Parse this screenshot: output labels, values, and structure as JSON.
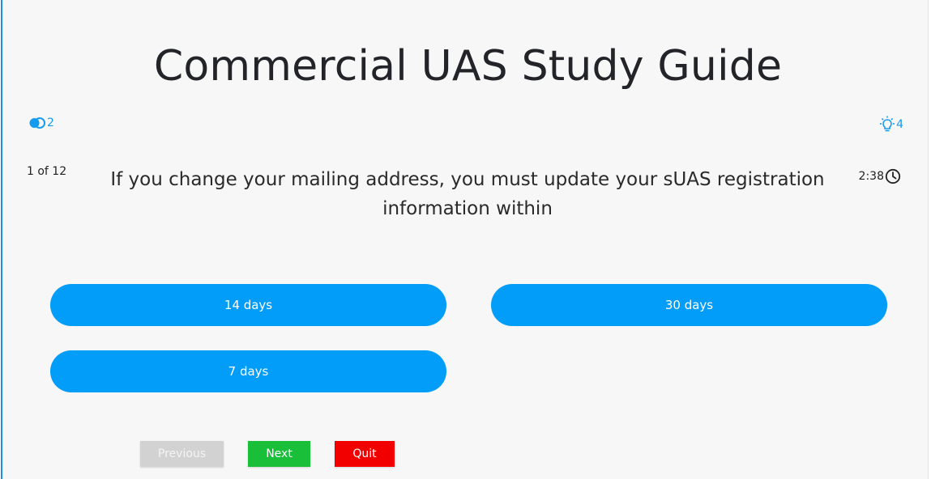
{
  "page": {
    "title": "Commercial UAS Study Guide"
  },
  "status": {
    "lifeline_count": "2",
    "hint_count": "4",
    "question_counter": "1 of 12",
    "timer": "2:38"
  },
  "question": {
    "text": "If you change your mailing address, you must update your sUAS registration information within"
  },
  "answers": [
    {
      "label": "14 days"
    },
    {
      "label": "30 days"
    },
    {
      "label": "7 days"
    }
  ],
  "nav": {
    "previous_label": "Previous",
    "next_label": "Next",
    "quit_label": "Quit"
  },
  "colors": {
    "accent": "#029df8",
    "next": "#19bf39",
    "quit": "#f20000",
    "disabled": "#d2d2d2"
  },
  "icons": {
    "lifeline": "fifty-fifty-icon",
    "hint": "lightbulb-icon",
    "timer": "clock-icon"
  }
}
